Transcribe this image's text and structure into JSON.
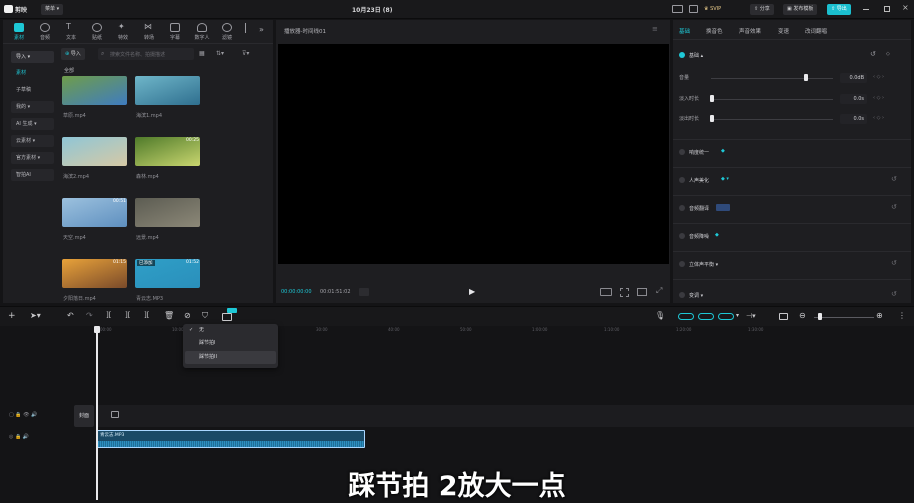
{
  "titlebar": {
    "app_name": "剪映",
    "menu_label": "菜单",
    "project_title": "10月23日 (8)",
    "svip_label": "SVIP",
    "share_label": "分享",
    "publish_label": "发布模板",
    "export_label": "导出"
  },
  "toolbar": {
    "tools": [
      {
        "label": "素材",
        "icon": "media-icon"
      },
      {
        "label": "音频",
        "icon": "audio-icon"
      },
      {
        "label": "文本",
        "icon": "text-icon"
      },
      {
        "label": "贴纸",
        "icon": "sticker-icon"
      },
      {
        "label": "特效",
        "icon": "effects-icon"
      },
      {
        "label": "转场",
        "icon": "transition-icon"
      },
      {
        "label": "字幕",
        "icon": "caption-icon"
      },
      {
        "label": "数字人",
        "icon": "avatar-icon"
      },
      {
        "label": "滤镜",
        "icon": "filter-icon"
      }
    ]
  },
  "media_sidebar": {
    "items": [
      "导入",
      "素材",
      "子草稿",
      "我的",
      "AI 生成",
      "云素材",
      "官方素材",
      "智拍AI"
    ]
  },
  "media_panel": {
    "import_label": "导入",
    "search_placeholder": "搜索文件名称、拍摄描述",
    "all_label": "全部",
    "clips": [
      {
        "name": "草原.mp4",
        "duration": "",
        "color_a": "#6f9d4a",
        "color_b": "#3f7cc0"
      },
      {
        "name": "海滨1.mp4",
        "duration": "",
        "color_a": "#6fb6c9",
        "color_b": "#2f6f8f"
      },
      {
        "name": "海滨2.mp4",
        "duration": "",
        "color_a": "#8fc6d6",
        "color_b": "#d6c9a5"
      },
      {
        "name": "森林.mp4",
        "duration": "00:25",
        "color_a": "#4f7a2a",
        "color_b": "#c9d66f"
      },
      {
        "name": "天空.mp4",
        "duration": "00:51",
        "color_a": "#9cc1de",
        "color_b": "#5e8fbf"
      },
      {
        "name": "远景.mp4",
        "duration": "",
        "color_a": "#5c5c52",
        "color_b": "#8c8878"
      },
      {
        "name": "夕阳落日.mp4",
        "duration": "01:15",
        "color_a": "#e8a23a",
        "color_b": "#7a4a2a"
      },
      {
        "name": "青云志.MP3",
        "duration": "01:52",
        "added": "已添加",
        "color_a": "#2f9fc7",
        "color_b": "#2a8fbb"
      }
    ]
  },
  "player": {
    "title": "播放器-时间线01",
    "current_time": "00:00:00:00",
    "total_time": "00:01:51:02"
  },
  "inspector": {
    "tabs": [
      "基础",
      "换音色",
      "声音效果",
      "变速",
      "改词翻唱"
    ],
    "section_title": "基础",
    "volume_label": "音量",
    "volume_value": "0.0dB",
    "fadein_label": "淡入时长",
    "fadein_value": "0.0s",
    "fadeout_label": "淡出时长",
    "fadeout_value": "0.0s",
    "sections": [
      "响度统一",
      "人声美化",
      "音频翻译",
      "音频降噪",
      "立体声平衡",
      "变调"
    ],
    "volume_level": 0.78
  },
  "timeline": {
    "ruler": [
      "00:00",
      "10:00",
      "20:00",
      "30:00",
      "40:00",
      "50:00",
      "1:00:00",
      "1:10:00",
      "1:20:00",
      "1:30:00"
    ],
    "beat_menu": {
      "items": [
        "无",
        "踩节拍I",
        "踩节拍II"
      ],
      "checked": "无"
    },
    "cover_label": "封面",
    "audio_clip_label": "青云志.MP3",
    "caption": "踩节拍 2放大一点"
  }
}
